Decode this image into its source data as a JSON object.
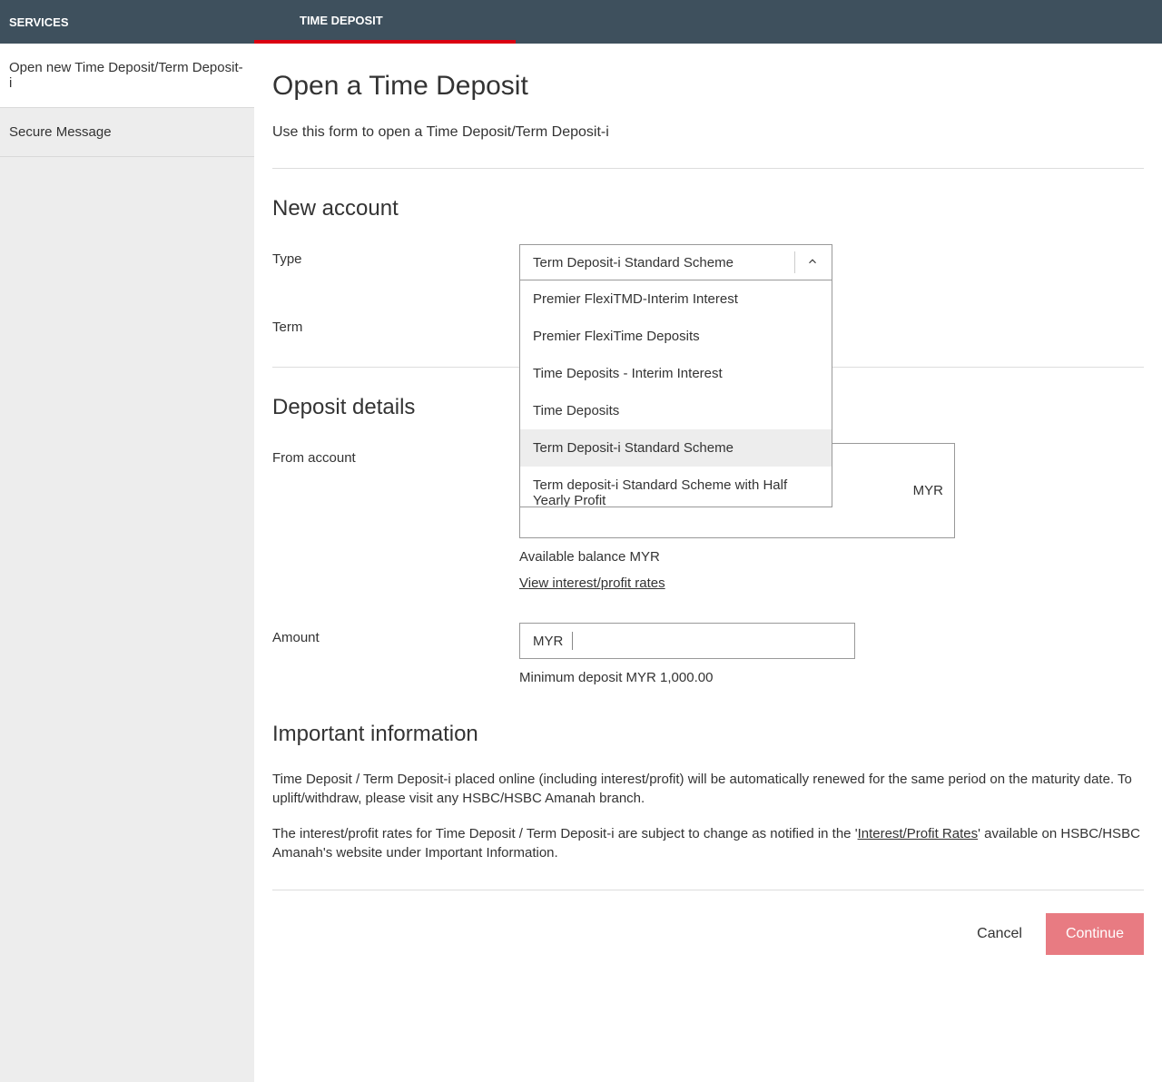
{
  "header": {
    "services": "SERVICES",
    "timedeposit": "TIME DEPOSIT"
  },
  "sidebar": {
    "items": [
      {
        "label": "Open new Time Deposit/Term Deposit-i"
      },
      {
        "label": "Secure Message"
      }
    ]
  },
  "page": {
    "title": "Open a Time Deposit",
    "subtitle": "Use this form to open a Time Deposit/Term Deposit-i"
  },
  "new_account": {
    "heading": "New account",
    "type_label": "Type",
    "type_selected": "Term Deposit-i Standard Scheme",
    "type_options": [
      "Premier FlexiTMD-Interim Interest",
      "Premier FlexiTime Deposits",
      "Time Deposits - Interim Interest",
      "Time Deposits",
      "Term Deposit-i Standard Scheme",
      "Term deposit-i Standard Scheme with Half Yearly Profit"
    ],
    "term_label": "Term"
  },
  "deposit_details": {
    "heading": "Deposit details",
    "from_account_label": "From account",
    "from_account_currency": "MYR",
    "available_balance": "Available balance MYR",
    "rates_link": "View interest/profit rates",
    "amount_label": "Amount",
    "amount_prefix": "MYR",
    "minimum_deposit": "Minimum deposit MYR 1,000.00"
  },
  "important": {
    "heading": "Important information",
    "p1": "Time Deposit / Term Deposit-i placed online (including interest/profit) will be automatically renewed for the same period on the maturity date. To uplift/withdraw, please visit any HSBC/HSBC Amanah branch.",
    "p2_pre": "The interest/profit rates for Time Deposit / Term Deposit-i are subject to change as notified in the '",
    "p2_link": "Interest/Profit Rates",
    "p2_post": "' available on HSBC/HSBC Amanah's website under Important Information."
  },
  "actions": {
    "cancel": "Cancel",
    "continue": "Continue"
  }
}
